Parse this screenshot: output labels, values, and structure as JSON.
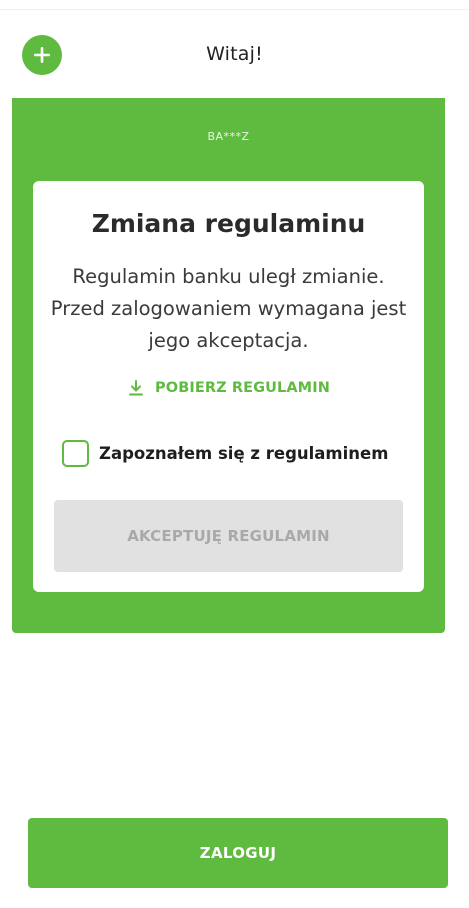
{
  "header": {
    "title": "Witaj!",
    "add_icon": "plus-icon"
  },
  "panel": {
    "user_code": "BA***Z"
  },
  "terms_card": {
    "title": "Zmiana regulaminu",
    "message": "Regulamin banku uległ zmianie. Przed zalogowaniem wymagana jest jego akceptacja.",
    "download_icon": "download-icon",
    "download_label": "POBIERZ REGULAMIN",
    "consent_label": "Zapoznałem się z regulaminem",
    "consent_checked": false,
    "accept_label": "AKCEPTUJĘ REGULAMIN",
    "accept_enabled": false
  },
  "footer": {
    "login_label": "ZALOGUJ"
  },
  "colors": {
    "brand_green": "#5fbb3f",
    "disabled_button": "#e1e1e1",
    "disabled_text": "#a9a9a9"
  }
}
